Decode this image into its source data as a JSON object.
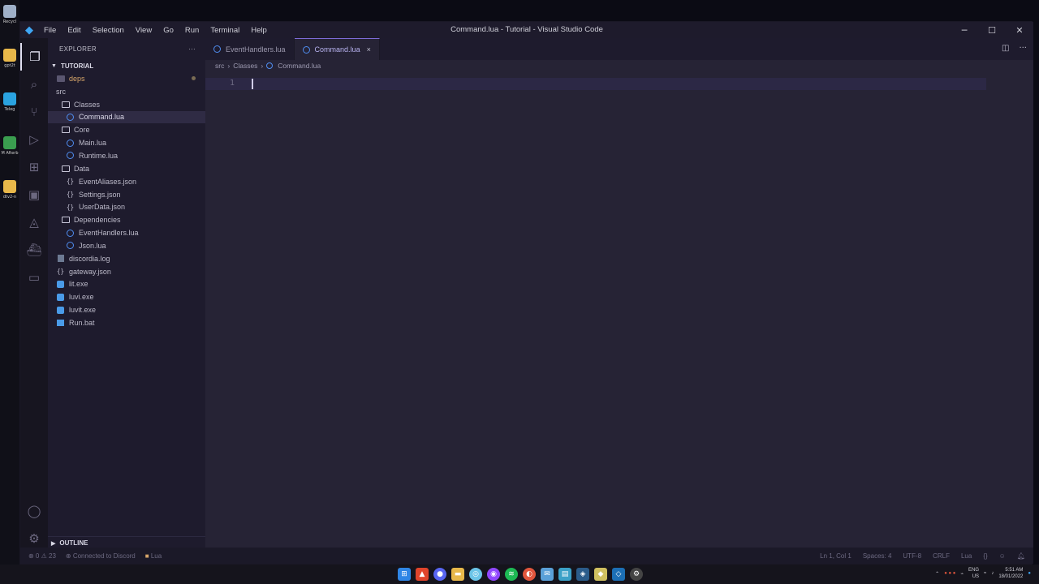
{
  "desktop_icons": [
    {
      "label": "Recycl",
      "color": "#9fb0c8"
    },
    {
      "label": "gpt2t",
      "color": "#e8b84a"
    },
    {
      "label": "Teleg",
      "color": "#2aa3e0"
    },
    {
      "label": "M Afterb",
      "color": "#3a9e4f"
    },
    {
      "label": "dtv2-n",
      "color": "#e8b84a"
    }
  ],
  "window": {
    "title": "Command.lua - Tutorial - Visual Studio Code",
    "menu": [
      "File",
      "Edit",
      "Selection",
      "View",
      "Go",
      "Run",
      "Terminal",
      "Help"
    ]
  },
  "activity_bar": [
    "files-icon",
    "search-icon",
    "source-control-icon",
    "run-debug-icon",
    "extensions-icon",
    "remote-explorer-icon",
    "azure-icon",
    "docker-icon",
    "database-icon",
    "account-icon",
    "settings-gear-icon"
  ],
  "sidebar": {
    "header": "EXPLORER",
    "more": "···",
    "section": "TUTORIAL",
    "tree": [
      {
        "label": "deps",
        "type": "folder-closed",
        "depth": 0,
        "color": "#d7a66a",
        "modified": true
      },
      {
        "label": "src",
        "type": "folder-none",
        "depth": 0
      },
      {
        "label": "Classes",
        "type": "folder",
        "depth": 1
      },
      {
        "label": "Command.lua",
        "type": "lua",
        "depth": 2,
        "selected": true
      },
      {
        "label": "Core",
        "type": "folder",
        "depth": 1
      },
      {
        "label": "Main.lua",
        "type": "lua",
        "depth": 2
      },
      {
        "label": "Runtime.lua",
        "type": "lua",
        "depth": 2
      },
      {
        "label": "Data",
        "type": "folder",
        "depth": 1
      },
      {
        "label": "EventAliases.json",
        "type": "json",
        "depth": 2
      },
      {
        "label": "Settings.json",
        "type": "json",
        "depth": 2
      },
      {
        "label": "UserData.json",
        "type": "json",
        "depth": 2
      },
      {
        "label": "Dependencies",
        "type": "folder",
        "depth": 1
      },
      {
        "label": "EventHandlers.lua",
        "type": "lua",
        "depth": 2
      },
      {
        "label": "Json.lua",
        "type": "lua",
        "depth": 2
      },
      {
        "label": "discordia.log",
        "type": "log",
        "depth": 0
      },
      {
        "label": "gateway.json",
        "type": "json",
        "depth": 0
      },
      {
        "label": "lit.exe",
        "type": "exe",
        "depth": 0
      },
      {
        "label": "luvi.exe",
        "type": "exe",
        "depth": 0
      },
      {
        "label": "luvit.exe",
        "type": "exe",
        "depth": 0
      },
      {
        "label": "Run.bat",
        "type": "bat",
        "depth": 0
      }
    ],
    "outline": "OUTLINE"
  },
  "editor": {
    "tabs": [
      {
        "label": "EventHandlers.lua",
        "active": false
      },
      {
        "label": "Command.lua",
        "active": true,
        "close": "×"
      }
    ],
    "breadcrumb": [
      "src",
      "Classes",
      "Command.lua"
    ],
    "line_number": "1"
  },
  "statusbar": {
    "problems": "⊗ 0 ⚠ 23",
    "discord": "Connected to Discord",
    "language_left": "Lua",
    "position": "Ln 1, Col 1",
    "spaces": "Spaces: 4",
    "encoding": "UTF-8",
    "eol": "CRLF",
    "language": "Lua"
  },
  "tray": {
    "lang_top": "ENG",
    "lang_bottom": "US",
    "time": "5:51 AM",
    "date": "18/01/2022"
  }
}
